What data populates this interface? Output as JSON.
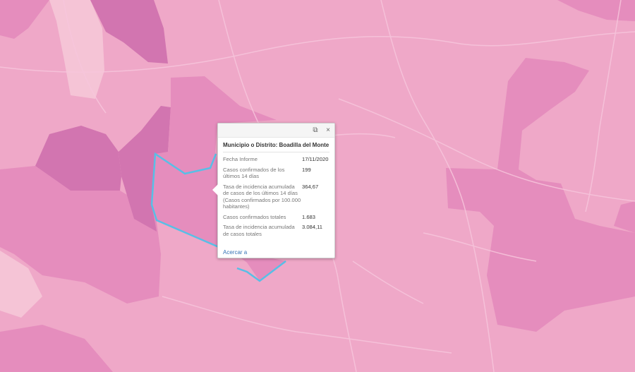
{
  "colors": {
    "base": "#efa8c8",
    "mid": "#e58dbd",
    "dark": "#d275b0",
    "light": "#f5c4d6",
    "road": "#f7c6dc",
    "highlight": "#58bfe6"
  },
  "popup": {
    "title": "Municipio o Distrito: Boadilla del Monte",
    "maximize_icon": "maximize-icon",
    "close_icon": "close-icon",
    "close_glyph": "×",
    "maximize_glyph": "⧉",
    "fields": [
      {
        "name": "Fecha Informe",
        "value": "17/11/2020"
      },
      {
        "name": "Casos confirmados de los últimos 14 días",
        "value": "199"
      },
      {
        "name": "Tasa de incidencia acumulada de casos de los últimos 14 días (Casos confirmados por 100.000 habitantes)",
        "value": "364,67"
      },
      {
        "name": "Casos confirmados totales",
        "value": "1.683"
      },
      {
        "name": "Tasa de incidencia acumulada de casos totales",
        "value": "3.084,11"
      }
    ],
    "zoom_link": "Acercar a"
  }
}
